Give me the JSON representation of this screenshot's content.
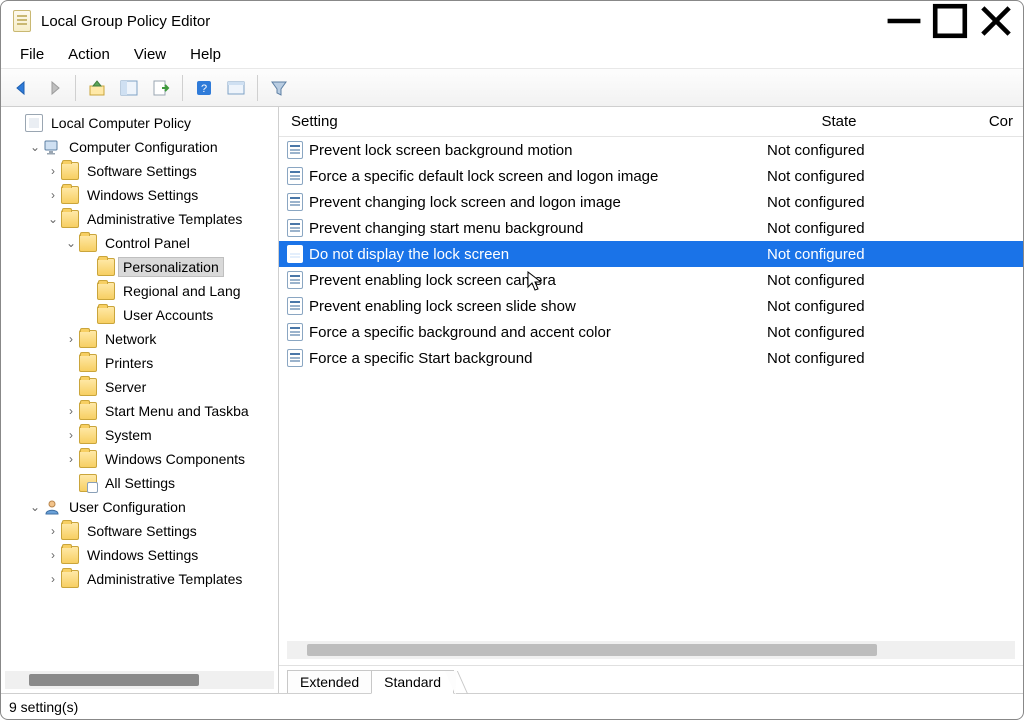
{
  "window": {
    "title": "Local Group Policy Editor"
  },
  "menu": {
    "file": "File",
    "action": "Action",
    "view": "View",
    "help": "Help"
  },
  "tree": {
    "root": "Local Computer Policy",
    "computer_config": "Computer Configuration",
    "software_settings": "Software Settings",
    "windows_settings": "Windows Settings",
    "admin_templates": "Administrative Templates",
    "control_panel": "Control Panel",
    "personalization": "Personalization",
    "regional_lang": "Regional and Lang",
    "user_accounts": "User Accounts",
    "network": "Network",
    "printers": "Printers",
    "server": "Server",
    "start_menu": "Start Menu and Taskba",
    "system": "System",
    "windows_components": "Windows Components",
    "all_settings": "All Settings",
    "user_config": "User Configuration",
    "uc_software_settings": "Software Settings",
    "uc_windows_settings": "Windows Settings",
    "uc_admin_templates": "Administrative Templates"
  },
  "columns": {
    "setting": "Setting",
    "state": "State",
    "comment": "Cor"
  },
  "state_not_configured": "Not configured",
  "settings": {
    "i0": "Prevent lock screen background motion",
    "i1": "Force a specific default lock screen and logon image",
    "i2": "Prevent changing lock screen and logon image",
    "i3": "Prevent changing start menu background",
    "i4": "Do not display the lock screen",
    "i5": "Prevent enabling lock screen camera",
    "i6": "Prevent enabling lock screen slide show",
    "i7": "Force a specific background and accent color",
    "i8": "Force a specific Start background"
  },
  "tabs": {
    "extended": "Extended",
    "standard": "Standard"
  },
  "status": "9 setting(s)"
}
